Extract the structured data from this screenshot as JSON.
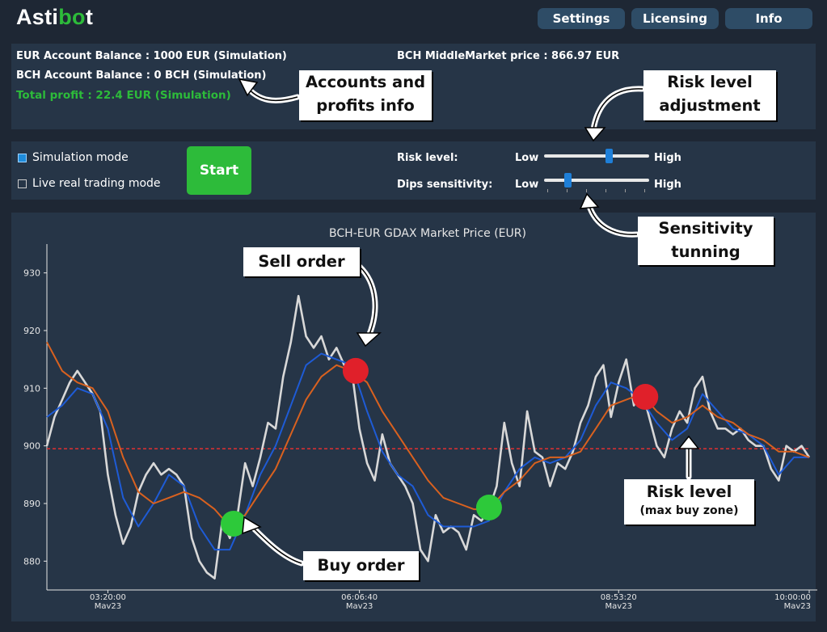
{
  "app": {
    "logo_pre": "Asti",
    "logo_accent": "bo",
    "logo_post": "t"
  },
  "nav": {
    "settings": "Settings",
    "licensing": "Licensing",
    "info": "Info"
  },
  "account": {
    "eur_balance": "EUR Account Balance : 1000 EUR (Simulation)",
    "bch_balance": "BCH Account Balance : 0 BCH (Simulation)",
    "total_profit": "Total profit : 22.4 EUR (Simulation)",
    "bch_price": "BCH MiddleMarket price : 866.97 EUR"
  },
  "controls": {
    "simulation_mode": "Simulation mode",
    "simulation_checked": true,
    "live_mode": "Live real trading mode",
    "live_checked": false,
    "start_label": "Start",
    "risk_label": "Risk level:",
    "risk_low": "Low",
    "risk_high": "High",
    "risk_value": 0.62,
    "dips_label": "Dips sensitivity:",
    "dips_low": "Low",
    "dips_high": "High",
    "dips_value": 0.23
  },
  "annotations": {
    "accounts": "Accounts and\nprofits info",
    "risk_adjust": "Risk level\nadjustment",
    "sensitivity": "Sensitivity\ntunning",
    "sell": "Sell order",
    "buy": "Buy order",
    "risk_zone_title": "Risk level",
    "risk_zone_sub": "(max buy zone)"
  },
  "colors": {
    "price": "#d8d8d8",
    "fast_ma": "#1e5bd6",
    "slow_ma": "#d9611f",
    "risk_line": "#e03030",
    "buy_marker": "#2dc93a",
    "sell_marker": "#e0202a",
    "accent": "#2dbb3a"
  },
  "chart_data": {
    "type": "line",
    "title": "BCH-EUR GDAX Market Price (EUR)",
    "yticks": [
      880,
      890,
      900,
      910,
      920,
      930
    ],
    "ylim": [
      875,
      935
    ],
    "xlim": [
      0,
      100
    ],
    "xticks": [
      {
        "x": 8,
        "time": "03:20:00",
        "date": "Mav23"
      },
      {
        "x": 41,
        "time": "06:06:40",
        "date": "Mav23"
      },
      {
        "x": 75,
        "time": "08:53:20",
        "date": "Mav23"
      },
      {
        "x": 100,
        "time": "10:00:00",
        "date": "Mav23"
      }
    ],
    "risk_level": 899.5,
    "buy_orders": [
      {
        "x": 24.5,
        "y": 886.5
      },
      {
        "x": 58,
        "y": 889.3
      }
    ],
    "sell_orders": [
      {
        "x": 40.5,
        "y": 913
      },
      {
        "x": 78.5,
        "y": 908.5
      }
    ],
    "series": [
      {
        "key": "price",
        "values": [
          [
            0,
            900
          ],
          [
            1,
            905
          ],
          [
            2,
            908
          ],
          [
            3,
            911
          ],
          [
            4,
            913
          ],
          [
            5,
            911
          ],
          [
            6,
            909
          ],
          [
            7,
            906
          ],
          [
            8,
            895
          ],
          [
            9,
            888
          ],
          [
            10,
            883
          ],
          [
            11,
            886
          ],
          [
            12,
            892
          ],
          [
            13,
            895
          ],
          [
            14,
            897
          ],
          [
            15,
            895
          ],
          [
            16,
            896
          ],
          [
            17,
            895
          ],
          [
            18,
            893
          ],
          [
            19,
            884
          ],
          [
            20,
            880
          ],
          [
            21,
            878
          ],
          [
            22,
            877
          ],
          [
            23,
            887
          ],
          [
            24,
            884
          ],
          [
            25,
            888
          ],
          [
            26,
            897
          ],
          [
            27,
            893
          ],
          [
            28,
            898
          ],
          [
            29,
            904
          ],
          [
            30,
            903
          ],
          [
            31,
            912
          ],
          [
            32,
            918
          ],
          [
            33,
            926
          ],
          [
            34,
            919
          ],
          [
            35,
            917
          ],
          [
            36,
            919
          ],
          [
            37,
            915
          ],
          [
            38,
            917
          ],
          [
            39,
            914
          ],
          [
            40,
            913
          ],
          [
            41,
            903
          ],
          [
            42,
            897
          ],
          [
            43,
            894
          ],
          [
            44,
            902
          ],
          [
            45,
            897
          ],
          [
            46,
            895
          ],
          [
            47,
            893
          ],
          [
            48,
            890
          ],
          [
            49,
            882
          ],
          [
            50,
            880
          ],
          [
            51,
            888
          ],
          [
            52,
            885
          ],
          [
            53,
            886
          ],
          [
            54,
            885
          ],
          [
            55,
            882
          ],
          [
            56,
            888
          ],
          [
            57,
            887
          ],
          [
            58,
            889
          ],
          [
            59,
            893
          ],
          [
            60,
            904
          ],
          [
            61,
            897
          ],
          [
            62,
            893
          ],
          [
            63,
            906
          ],
          [
            64,
            899
          ],
          [
            65,
            898
          ],
          [
            66,
            893
          ],
          [
            67,
            897
          ],
          [
            68,
            896
          ],
          [
            69,
            899
          ],
          [
            70,
            904
          ],
          [
            71,
            907
          ],
          [
            72,
            912
          ],
          [
            73,
            914
          ],
          [
            74,
            905
          ],
          [
            75,
            911
          ],
          [
            76,
            915
          ],
          [
            77,
            907
          ],
          [
            78,
            910
          ],
          [
            79,
            905
          ],
          [
            80,
            900
          ],
          [
            81,
            898
          ],
          [
            82,
            903
          ],
          [
            83,
            906
          ],
          [
            84,
            904
          ],
          [
            85,
            910
          ],
          [
            86,
            912
          ],
          [
            87,
            906
          ],
          [
            88,
            903
          ],
          [
            89,
            903
          ],
          [
            90,
            902
          ],
          [
            91,
            903
          ],
          [
            92,
            901
          ],
          [
            93,
            900
          ],
          [
            94,
            900
          ],
          [
            95,
            896
          ],
          [
            96,
            894
          ],
          [
            97,
            900
          ],
          [
            98,
            899
          ],
          [
            99,
            900
          ],
          [
            100,
            898
          ]
        ]
      },
      {
        "key": "fast_ma",
        "values": [
          [
            0,
            905
          ],
          [
            2,
            907
          ],
          [
            4,
            910
          ],
          [
            6,
            909
          ],
          [
            8,
            903
          ],
          [
            10,
            891
          ],
          [
            12,
            886
          ],
          [
            14,
            890
          ],
          [
            16,
            895
          ],
          [
            18,
            893
          ],
          [
            20,
            886
          ],
          [
            22,
            882
          ],
          [
            24,
            882
          ],
          [
            26,
            888
          ],
          [
            28,
            895
          ],
          [
            30,
            900
          ],
          [
            32,
            907
          ],
          [
            34,
            914
          ],
          [
            36,
            916
          ],
          [
            38,
            915
          ],
          [
            40,
            914
          ],
          [
            42,
            906
          ],
          [
            44,
            899
          ],
          [
            46,
            895
          ],
          [
            48,
            893
          ],
          [
            50,
            888
          ],
          [
            52,
            886
          ],
          [
            54,
            886
          ],
          [
            56,
            886
          ],
          [
            58,
            887
          ],
          [
            60,
            892
          ],
          [
            62,
            896
          ],
          [
            64,
            898
          ],
          [
            66,
            897
          ],
          [
            68,
            898
          ],
          [
            70,
            901
          ],
          [
            72,
            907
          ],
          [
            74,
            911
          ],
          [
            76,
            910
          ],
          [
            78,
            908
          ],
          [
            80,
            904
          ],
          [
            82,
            901
          ],
          [
            84,
            903
          ],
          [
            86,
            909
          ],
          [
            88,
            906
          ],
          [
            90,
            903
          ],
          [
            92,
            902
          ],
          [
            94,
            900
          ],
          [
            96,
            895
          ],
          [
            98,
            898
          ],
          [
            100,
            898
          ]
        ]
      },
      {
        "key": "slow_ma",
        "values": [
          [
            0,
            918
          ],
          [
            2,
            913
          ],
          [
            4,
            911
          ],
          [
            6,
            910
          ],
          [
            8,
            906
          ],
          [
            10,
            898
          ],
          [
            12,
            892
          ],
          [
            14,
            890
          ],
          [
            16,
            891
          ],
          [
            18,
            892
          ],
          [
            20,
            891
          ],
          [
            22,
            889
          ],
          [
            24,
            886
          ],
          [
            26,
            888
          ],
          [
            28,
            892
          ],
          [
            30,
            896
          ],
          [
            32,
            902
          ],
          [
            34,
            908
          ],
          [
            36,
            912
          ],
          [
            38,
            914
          ],
          [
            40,
            913
          ],
          [
            42,
            911
          ],
          [
            44,
            906
          ],
          [
            46,
            902
          ],
          [
            48,
            898
          ],
          [
            50,
            894
          ],
          [
            52,
            891
          ],
          [
            54,
            890
          ],
          [
            56,
            889
          ],
          [
            58,
            889
          ],
          [
            60,
            892
          ],
          [
            62,
            894
          ],
          [
            64,
            897
          ],
          [
            66,
            898
          ],
          [
            68,
            898
          ],
          [
            70,
            899
          ],
          [
            72,
            903
          ],
          [
            74,
            907
          ],
          [
            76,
            908
          ],
          [
            78,
            909
          ],
          [
            80,
            906
          ],
          [
            82,
            904
          ],
          [
            84,
            905
          ],
          [
            86,
            907
          ],
          [
            88,
            905
          ],
          [
            90,
            904
          ],
          [
            92,
            902
          ],
          [
            94,
            901
          ],
          [
            96,
            899
          ],
          [
            98,
            899
          ],
          [
            100,
            898
          ]
        ]
      }
    ]
  }
}
